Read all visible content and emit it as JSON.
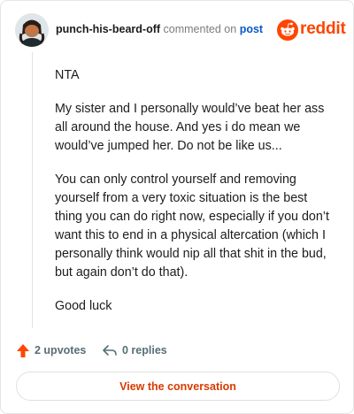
{
  "header": {
    "username": "punch-his-beard-off",
    "commented_on": "commented on",
    "post_link": "post",
    "brand": "reddit"
  },
  "icons": {
    "avatar": "snoo-avatar",
    "logo": "reddit-snoo-icon",
    "upvote": "upvote-arrow-icon",
    "reply": "reply-arrow-icon"
  },
  "colors": {
    "brand": "#ff4500",
    "link": "#0a58ca",
    "button_text": "#d93a00"
  },
  "comment": {
    "paragraphs": [
      "NTA",
      "My sister and I personally would’ve beat her ass all around the house. And yes i do mean we would’ve jumped her. Do not be like us...",
      "You can only control yourself and removing yourself from a very toxic situation is the best thing you can do right now, especially if you don’t want this to end in a physical altercation (which I personally think would nip all that shit in the bud, but again don’t do that).",
      "Good luck"
    ]
  },
  "actions": {
    "upvotes": "2 upvotes",
    "replies": "0 replies"
  },
  "footer": {
    "view_button": "View the conversation"
  }
}
